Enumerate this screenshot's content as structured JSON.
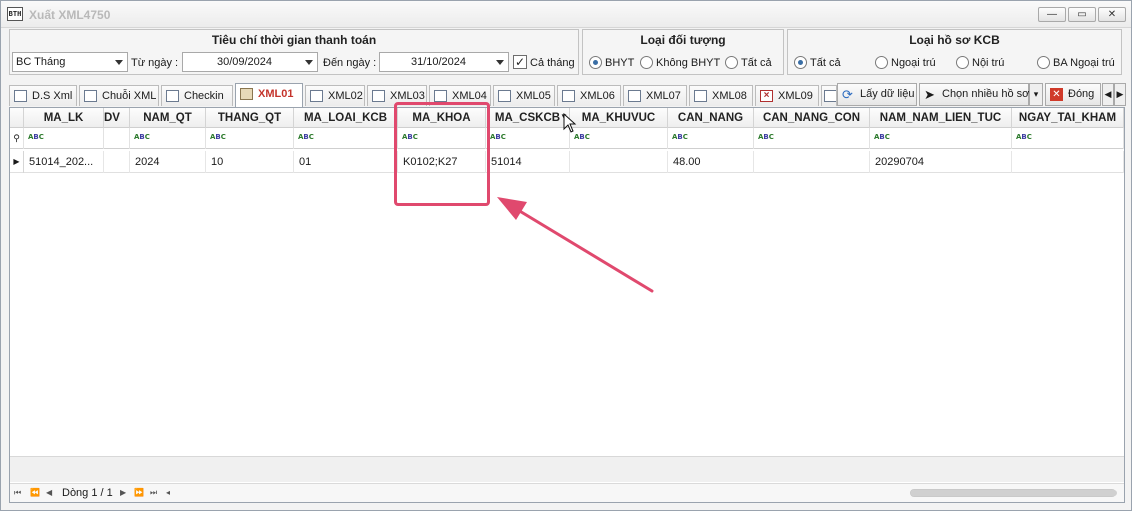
{
  "window": {
    "title": "Xuất XML4750",
    "app_icon": "BTH",
    "minimize": "—",
    "maximize": "▭",
    "close": "✕"
  },
  "filters": {
    "time_group_title": "Tiêu chí thời gian thanh toán",
    "report_type": "BC Tháng",
    "from_label": "Từ ngày :",
    "from_date": "30/09/2024",
    "to_label": "Đến ngày :",
    "to_date": "31/10/2024",
    "whole_month_label": "Cả tháng",
    "whole_month_checked": true,
    "object_group_title": "Loại đối tượng",
    "object_options": [
      "BHYT",
      "Không BHYT",
      "Tất cả"
    ],
    "object_selected": "BHYT",
    "record_group_title": "Loại hồ sơ KCB",
    "record_options": [
      "Tất cả",
      "Ngoại trú",
      "Nội trú",
      "BA Ngoại trú"
    ],
    "record_selected": "Tất cả"
  },
  "tabs": [
    "D.S Xml",
    "Chuỗi XML",
    "Checkin",
    "XML01",
    "XML02",
    "XML03",
    "XML04",
    "XML05",
    "XML06",
    "XML07",
    "XML08",
    "XML09"
  ],
  "active_tab": "XML01",
  "toolbar": {
    "load_label": "Lấy dữ liệu",
    "select_label": "Chọn nhiều hồ sơ",
    "close_label": "Đóng"
  },
  "grid": {
    "columns": [
      "MA_LK",
      "DV",
      "NAM_QT",
      "THANG_QT",
      "MA_LOAI_KCB",
      "MA_KHOA",
      "MA_CSKCB",
      "MA_KHUVUC",
      "CAN_NANG",
      "CAN_NANG_CON",
      "NAM_NAM_LIEN_TUC",
      "NGAY_TAI_KHAM"
    ],
    "rows": [
      [
        "51014_202...",
        "",
        "2024",
        "10",
        "01",
        "K0102;K27",
        "51014",
        "",
        "48.00",
        "",
        "20290704",
        ""
      ]
    ],
    "highlighted_column": "MA_KHOA"
  },
  "status": {
    "row_info": "Dòng 1 / 1"
  },
  "colors": {
    "highlight": "#e0496e",
    "active_tab_text": "#c4342c",
    "radio_dot": "#3a6ea5"
  }
}
